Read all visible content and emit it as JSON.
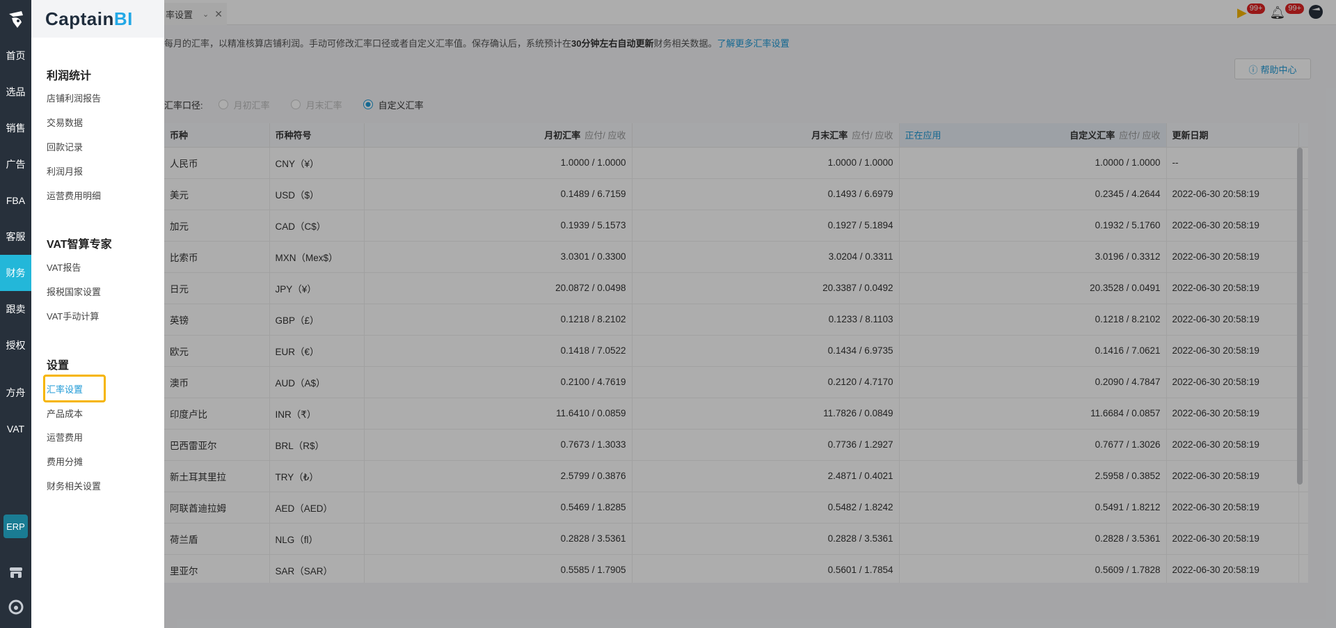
{
  "rail": {
    "items": [
      {
        "label": "首页"
      },
      {
        "label": "选品"
      },
      {
        "label": "销售"
      },
      {
        "label": "广告"
      },
      {
        "label": "FBA"
      },
      {
        "label": "客服"
      },
      {
        "label": "财务"
      },
      {
        "label": "跟卖"
      },
      {
        "label": "授权"
      },
      {
        "label": "方舟"
      },
      {
        "label": "VAT"
      }
    ],
    "erp": "ERP"
  },
  "panel": {
    "brand_main": "Captain",
    "brand_accent": "BI",
    "sections": [
      {
        "title": "利润统计",
        "items": [
          "店铺利润报告",
          "交易数据",
          "回款记录",
          "利润月报",
          "运营费用明细"
        ]
      },
      {
        "title": "VAT智算专家",
        "items": [
          "VAT报告",
          "报税国家设置",
          "VAT手动计算"
        ]
      },
      {
        "title": "设置",
        "items": [
          "汇率设置",
          "产品成本",
          "运营费用",
          "费用分摊",
          "财务相关设置"
        ]
      }
    ]
  },
  "tabbar": {
    "tab_label": "率设置",
    "badge1": "99+",
    "badge2": "99+"
  },
  "notice": {
    "text_a": "每月的汇率，以精准核算店铺利润。手动可修改汇率口径或者自定义汇率值。保存确认后，系统预计在",
    "bold": "30分钟左右自动更新",
    "text_b": "财务相关数据。",
    "link": "了解更多汇率设置"
  },
  "help": {
    "label": "帮助中心"
  },
  "rate_basis": {
    "label": "汇率口径:",
    "options": [
      "月初汇率",
      "月末汇率",
      "自定义汇率"
    ],
    "selected": "自定义汇率"
  },
  "table": {
    "headers": {
      "currency": "币种",
      "symbol": "币种符号",
      "start": "月初汇率",
      "end": "月末汇率",
      "sub": "应付/ 应收",
      "applied": "正在应用",
      "custom": "自定义汇率",
      "updated": "更新日期"
    },
    "rows": [
      {
        "currency": "人民币",
        "symbol": "CNY（¥）",
        "start": "1.0000  /  1.0000",
        "end": "1.0000 / 1.0000",
        "custom": "1.0000 / 1.0000",
        "updated": "--"
      },
      {
        "currency": "美元",
        "symbol": "USD（$）",
        "start": "0.1489  /  6.7159",
        "end": "0.1493 / 6.6979",
        "custom": "0.2345 / 4.2644",
        "updated": "2022-06-30 20:58:19"
      },
      {
        "currency": "加元",
        "symbol": "CAD（C$）",
        "start": "0.1939  /  5.1573",
        "end": "0.1927 / 5.1894",
        "custom": "0.1932 / 5.1760",
        "updated": "2022-06-30 20:58:19"
      },
      {
        "currency": "比索币",
        "symbol": "MXN（Mex$）",
        "start": "3.0301  /  0.3300",
        "end": "3.0204 / 0.3311",
        "custom": "3.0196 / 0.3312",
        "updated": "2022-06-30 20:58:19"
      },
      {
        "currency": "日元",
        "symbol": "JPY（¥）",
        "start": "20.0872  /  0.0498",
        "end": "20.3387 / 0.0492",
        "custom": "20.3528 / 0.0491",
        "updated": "2022-06-30 20:58:19"
      },
      {
        "currency": "英镑",
        "symbol": "GBP（£）",
        "start": "0.1218  /  8.2102",
        "end": "0.1233 / 8.1103",
        "custom": "0.1218 / 8.2102",
        "updated": "2022-06-30 20:58:19"
      },
      {
        "currency": "欧元",
        "symbol": "EUR（€）",
        "start": "0.1418  /  7.0522",
        "end": "0.1434 / 6.9735",
        "custom": "0.1416 / 7.0621",
        "updated": "2022-06-30 20:58:19"
      },
      {
        "currency": "澳币",
        "symbol": "AUD（A$）",
        "start": "0.2100  /  4.7619",
        "end": "0.2120 / 4.7170",
        "custom": "0.2090 / 4.7847",
        "updated": "2022-06-30 20:58:19"
      },
      {
        "currency": "印度卢比",
        "symbol": "INR（₹）",
        "start": "11.6410  /  0.0859",
        "end": "11.7826 / 0.0849",
        "custom": "11.6684 / 0.0857",
        "updated": "2022-06-30 20:58:19"
      },
      {
        "currency": "巴西雷亚尔",
        "symbol": "BRL（R$）",
        "start": "0.7673  /  1.3033",
        "end": "0.7736 / 1.2927",
        "custom": "0.7677 / 1.3026",
        "updated": "2022-06-30 20:58:19"
      },
      {
        "currency": "新土耳其里拉",
        "symbol": "TRY（₺）",
        "start": "2.5799  /  0.3876",
        "end": "2.4871 / 0.4021",
        "custom": "2.5958 / 0.3852",
        "updated": "2022-06-30 20:58:19"
      },
      {
        "currency": "阿联酋迪拉姆",
        "symbol": "AED（AED）",
        "start": "0.5469  /  1.8285",
        "end": "0.5482 / 1.8242",
        "custom": "0.5491 / 1.8212",
        "updated": "2022-06-30 20:58:19"
      },
      {
        "currency": "荷兰盾",
        "symbol": "NLG（fl）",
        "start": "0.2828  /  3.5361",
        "end": "0.2828 / 3.5361",
        "custom": "0.2828 / 3.5361",
        "updated": "2022-06-30 20:58:19"
      },
      {
        "currency": "里亚尔",
        "symbol": "SAR（SAR）",
        "start": "0.5585  /  1.7905",
        "end": "0.5601 / 1.7854",
        "custom": "0.5609 / 1.7828",
        "updated": "2022-06-30 20:58:19"
      }
    ]
  },
  "colors": {
    "accent": "#23b7d9",
    "link": "#1f9ad6",
    "rail": "#27303b",
    "highlight": "#f6b500"
  }
}
